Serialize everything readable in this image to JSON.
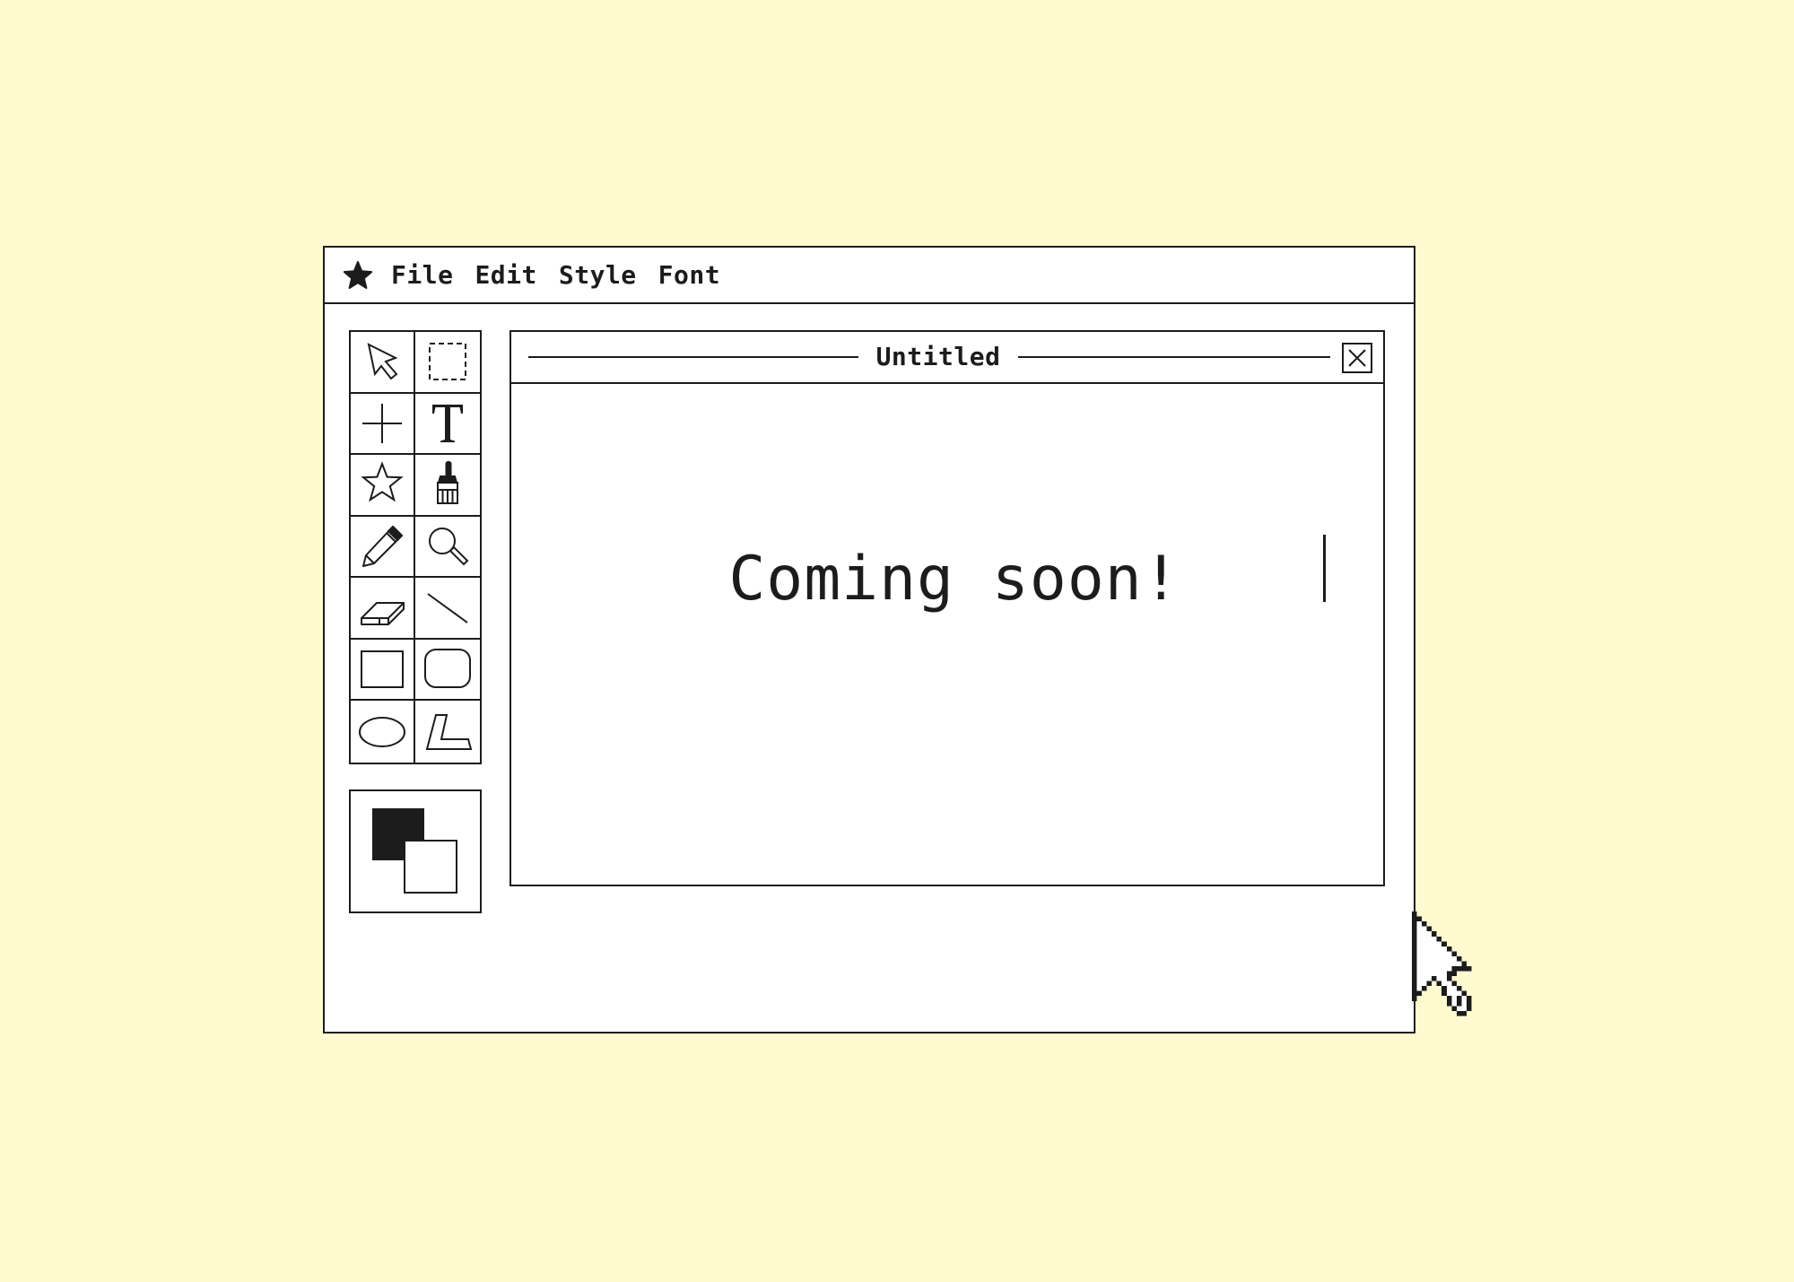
{
  "menubar": {
    "logo_icon": "star-icon",
    "items": [
      "File",
      "Edit",
      "Style",
      "Font"
    ]
  },
  "toolbox": {
    "tools": [
      {
        "name": "select-arrow",
        "icon": "arrow-cursor-icon"
      },
      {
        "name": "marquee-select",
        "icon": "dashed-rectangle-icon"
      },
      {
        "name": "crosshair",
        "icon": "plus-icon"
      },
      {
        "name": "text",
        "icon": "text-icon"
      },
      {
        "name": "star-shape",
        "icon": "star-icon"
      },
      {
        "name": "paint-brush",
        "icon": "brush-icon"
      },
      {
        "name": "pencil",
        "icon": "pencil-icon"
      },
      {
        "name": "magnifier",
        "icon": "magnifier-icon"
      },
      {
        "name": "eraser",
        "icon": "eraser-icon"
      },
      {
        "name": "line",
        "icon": "line-icon"
      },
      {
        "name": "rectangle",
        "icon": "rectangle-icon"
      },
      {
        "name": "rounded-rectangle",
        "icon": "rounded-rectangle-icon"
      },
      {
        "name": "ellipse",
        "icon": "ellipse-icon"
      },
      {
        "name": "polygon",
        "icon": "polygon-icon"
      }
    ]
  },
  "colors": {
    "background": "#fffad0",
    "ink": "#1c1c1c",
    "paper": "#ffffff",
    "foreground_swatch": "#1c1c1c",
    "background_swatch": "#ffffff"
  },
  "document": {
    "title": "Untitled",
    "content_text": "Coming soon!",
    "close_icon": "close-icon"
  },
  "cursor_icon": "mouse-pointer-icon"
}
